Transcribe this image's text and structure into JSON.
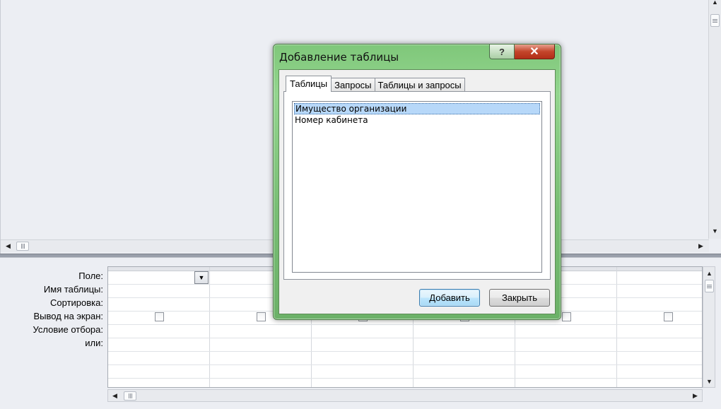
{
  "dialog": {
    "title": "Добавление таблицы",
    "help_label": "?",
    "close_label": "✕",
    "tabs": [
      {
        "label": "Таблицы",
        "active": true
      },
      {
        "label": "Запросы",
        "active": false
      },
      {
        "label": "Таблицы и запросы",
        "active": false
      }
    ],
    "list_items": [
      {
        "label": "Имущество организации",
        "selected": true
      },
      {
        "label": "Номер кабинета",
        "selected": false
      }
    ],
    "add_label": "Добавить",
    "close_button_label": "Закрыть"
  },
  "grid": {
    "row_labels": [
      "Поле:",
      "Имя таблицы:",
      "Сортировка:",
      "Вывод на экран:",
      "Условие отбора:",
      "или:"
    ],
    "dropdown_icon": "▼"
  },
  "scroll": {
    "up": "▲",
    "down": "▼",
    "left": "◀",
    "right": "▶"
  }
}
